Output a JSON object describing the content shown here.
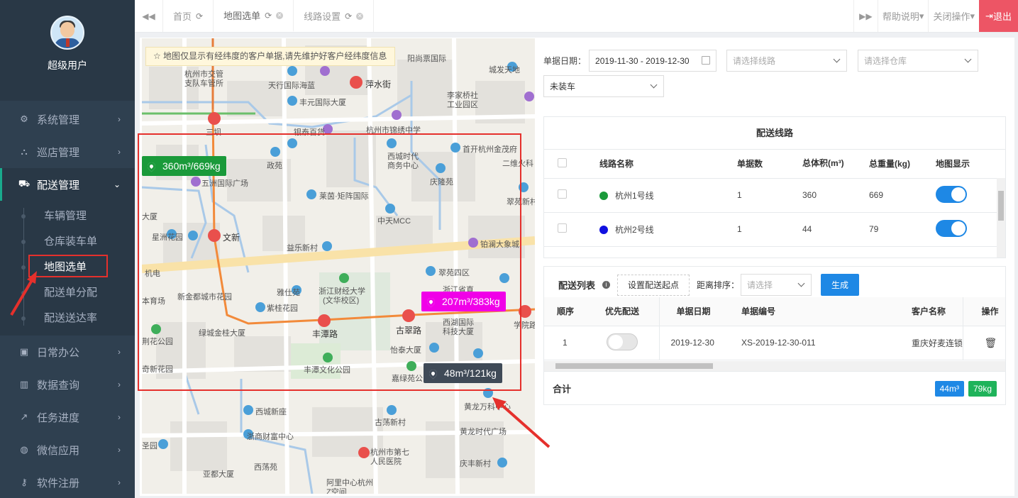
{
  "user": {
    "name": "超级用户"
  },
  "sidebar": {
    "items": [
      {
        "label": "系统管理",
        "icon": "gears-icon"
      },
      {
        "label": "巡店管理",
        "icon": "sitemap-icon"
      },
      {
        "label": "配送管理",
        "icon": "truck-icon",
        "active": true,
        "children": [
          "车辆管理",
          "仓库装车单",
          "地图选单",
          "配送单分配",
          "配送送达率"
        ]
      },
      {
        "label": "日常办公",
        "icon": "briefcase-icon"
      },
      {
        "label": "数据查询",
        "icon": "bar-chart-icon"
      },
      {
        "label": "任务进度",
        "icon": "line-chart-icon"
      },
      {
        "label": "微信应用",
        "icon": "wechat-icon"
      },
      {
        "label": "软件注册",
        "icon": "key-icon"
      }
    ]
  },
  "tabs": [
    {
      "label": "首页"
    },
    {
      "label": "地图选单"
    },
    {
      "label": "线路设置"
    }
  ],
  "header": {
    "help": "帮助说明",
    "close_ops": "关闭操作",
    "logout": "退出"
  },
  "map": {
    "notice": "☆ 地图仅显示有经纬度的客户单据,请先维护好客户经纬度信息",
    "badges": [
      {
        "text": "360m³/669kg",
        "color": "#1a9a3a"
      },
      {
        "text": "207m³/383kg",
        "color": "#f000e8"
      },
      {
        "text": "48m³/121kg",
        "color": "#3f4a57"
      }
    ],
    "labels": [
      "阳尚票国际",
      "杭州市交管",
      "支队车管所",
      "天行国际海蓝",
      "萍水街",
      "城发天地",
      "丰元国际大厦",
      "李家桥社",
      "工业园区",
      "三坝",
      "银泰百货",
      "杭州市锦绣中学",
      "首开杭州金茂府",
      "西城时代",
      "商务中心",
      "二维火科",
      "政苑",
      "庆隆苑",
      "五洲国际广场",
      "莱茵·矩阵国际",
      "翠苑新村",
      "大厦",
      "中天MCC",
      "星洲花园",
      "文新",
      "益乐新村",
      "铂澜大象城",
      "机电",
      "翠苑四区",
      "浙江财经大学",
      "(文华校区)",
      "浙江省直",
      "雅仕苑",
      "新金都城市花园",
      "本育场",
      "紫桂花园",
      "学院路",
      "绿城金桂大厦",
      "丰潭路",
      "古翠路",
      "西湖国际",
      "科技大厦",
      "荆花公园",
      "怡泰大厦",
      "奇新花园",
      "丰潭文化公园",
      "嘉绿苑公",
      "黄龙万科中心",
      "西城新座",
      "古荡新村",
      "黄龙时代广场",
      "浙商财富中心",
      "杭州市第七",
      "人民医院",
      "圣园",
      "西荡苑",
      "庆丰新村",
      "亚都大厦",
      "阿里中心杭州",
      "Z空间"
    ]
  },
  "filters": {
    "date_label": "单据日期：",
    "date_value": "2019-11-30 - 2019-12-30",
    "route_placeholder": "请选择线路",
    "warehouse_placeholder": "请选择仓库",
    "status_value": "未装车"
  },
  "routes": {
    "title": "配送线路",
    "columns": [
      "线路名称",
      "单据数",
      "总体积(m³)",
      "总重量(kg)",
      "地图显示"
    ],
    "rows": [
      {
        "name": "杭州1号线",
        "color": "#1a9a3a",
        "count": "1",
        "volume": "360",
        "weight": "669",
        "show": true
      },
      {
        "name": "杭州2号线",
        "color": "#1010e0",
        "count": "1",
        "volume": "44",
        "weight": "79",
        "show": true
      }
    ]
  },
  "delivery": {
    "title": "配送列表",
    "set_start": "设置配送起点",
    "sort_label": "距离排序：",
    "sort_placeholder": "请选择",
    "generate": "生成",
    "columns": [
      "顺序",
      "优先配送",
      "单据日期",
      "单据编号",
      "客户名称",
      "操作"
    ],
    "rows": [
      {
        "seq": "1",
        "priority": false,
        "date": "2019-12-30",
        "number": "XS-2019-12-30-011",
        "customer": "重庆好麦连锁"
      }
    ],
    "total_label": "合计",
    "total_volume": "44m³",
    "total_weight": "79kg"
  }
}
